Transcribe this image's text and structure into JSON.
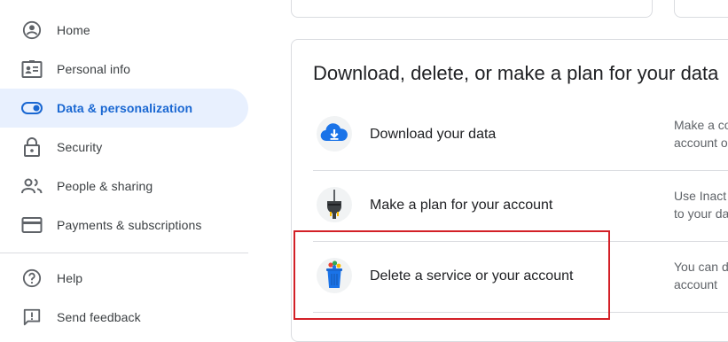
{
  "sidebar": {
    "items": [
      {
        "label": "Home",
        "icon": "account-circle-icon"
      },
      {
        "label": "Personal info",
        "icon": "id-card-icon"
      },
      {
        "label": "Data & personalization",
        "icon": "toggle-icon",
        "active": true
      },
      {
        "label": "Security",
        "icon": "lock-icon"
      },
      {
        "label": "People & sharing",
        "icon": "people-icon"
      },
      {
        "label": "Payments & subscriptions",
        "icon": "credit-card-icon"
      },
      {
        "label": "Help",
        "icon": "help-icon"
      },
      {
        "label": "Send feedback",
        "icon": "feedback-icon"
      }
    ]
  },
  "main": {
    "section_title": "Download, delete, or make a plan for your data",
    "rows": [
      {
        "title": "Download your data",
        "desc_line1": "Make a co",
        "desc_line2": "account o",
        "icon": "cloud-download-icon"
      },
      {
        "title": "Make a plan for your account",
        "desc_line1": "Use Inact",
        "desc_line2": "to your da",
        "icon": "plug-icon"
      },
      {
        "title": "Delete a service or your account",
        "desc_line1": "You can d",
        "desc_line2": "account",
        "icon": "trash-can-icon"
      }
    ]
  },
  "colors": {
    "accent": "#1967d2",
    "active_bg": "#e8f0fe",
    "highlight": "#d32027"
  }
}
